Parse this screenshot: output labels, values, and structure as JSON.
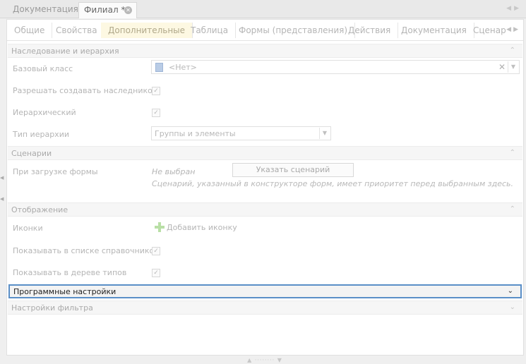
{
  "doc_tabs": [
    {
      "label": "Документация"
    },
    {
      "label": "Филиал *"
    }
  ],
  "section_tabs": [
    {
      "label": "Общие"
    },
    {
      "label": "Свойства"
    },
    {
      "label": "Дополнительные"
    },
    {
      "label": "Таблица"
    },
    {
      "label": "Формы (представления)"
    },
    {
      "label": "Действия"
    },
    {
      "label": "Документация"
    },
    {
      "label": "Сценар"
    }
  ],
  "groups": {
    "inheritance": "Наследование и иерархия",
    "scenarios": "Сценарии",
    "display": "Отображение",
    "program_settings": "Программные настройки",
    "filter_settings": "Настройки фильтра"
  },
  "fields": {
    "base_class_label": "Базовый класс",
    "base_class_value": "<Нет>",
    "allow_inherit_label": "Разрешать создавать наследников",
    "hierarchical_label": "Иерархический",
    "hierarchy_type_label": "Тип иерархии",
    "hierarchy_type_value": "Группы и элементы",
    "on_load_label": "При загрузке формы",
    "on_load_value": "Не выбран",
    "set_scenario_button": "Указать сценарий",
    "scenario_hint": "Сценарий, указанный в конструкторе форм, имеет приоритет перед выбранным здесь.",
    "icons_label": "Иконки",
    "add_icon_link": "Добавить иконку",
    "show_in_catalog_label": "Показывать в списке справочников",
    "show_in_tree_label": "Показывать в дереве типов"
  },
  "icons": {
    "check": "✓",
    "clear": "✕",
    "dropdown": "▼",
    "collapse": "⌃",
    "expand": "⌄",
    "tab_close": "✕",
    "nav_left": "◀",
    "nav_right": "▶"
  },
  "colors": {
    "selected_border": "#5a8fc7",
    "active_tab_bg": "#fdf8e2",
    "add_icon_green": "#b9dfa6"
  }
}
